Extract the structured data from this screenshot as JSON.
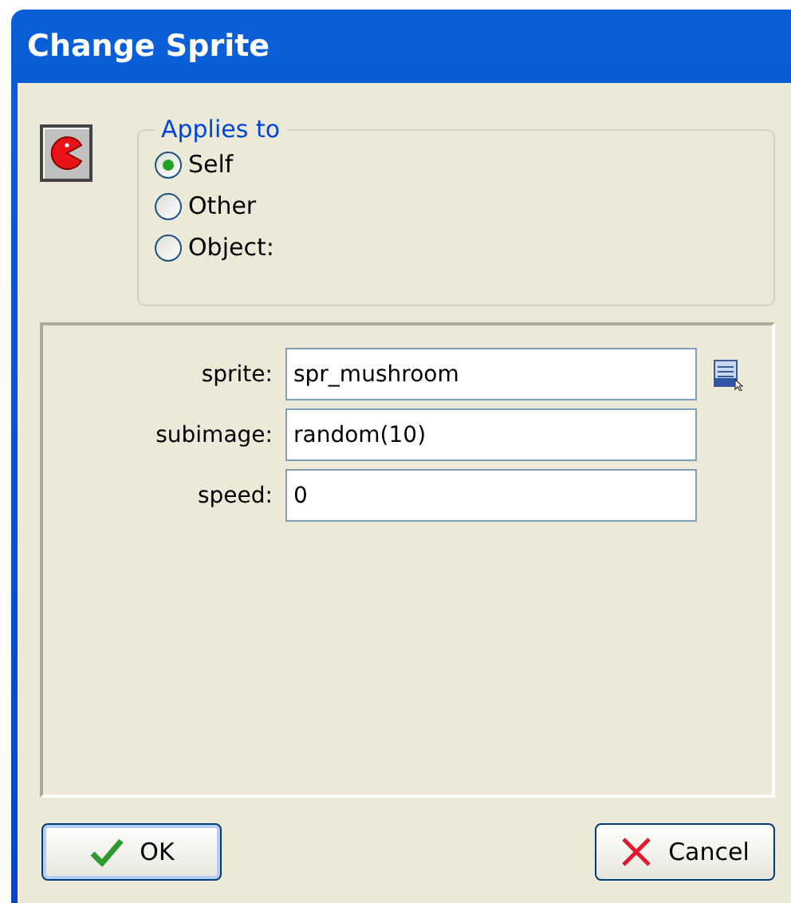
{
  "window": {
    "title": "Change Sprite"
  },
  "applies_to": {
    "label": "Applies to",
    "options": [
      {
        "label": "Self",
        "selected": true
      },
      {
        "label": "Other",
        "selected": false
      },
      {
        "label": "Object:",
        "selected": false
      }
    ]
  },
  "fields": [
    {
      "label": "sprite:",
      "value": "spr_mushroom",
      "kind": "picker"
    },
    {
      "label": "subimage:",
      "value": "random(10)",
      "kind": "text"
    },
    {
      "label": "speed:",
      "value": "0",
      "kind": "text"
    }
  ],
  "buttons": [
    {
      "label": "OK",
      "kind": "ok"
    },
    {
      "label": "Cancel",
      "kind": "cancel"
    }
  ]
}
